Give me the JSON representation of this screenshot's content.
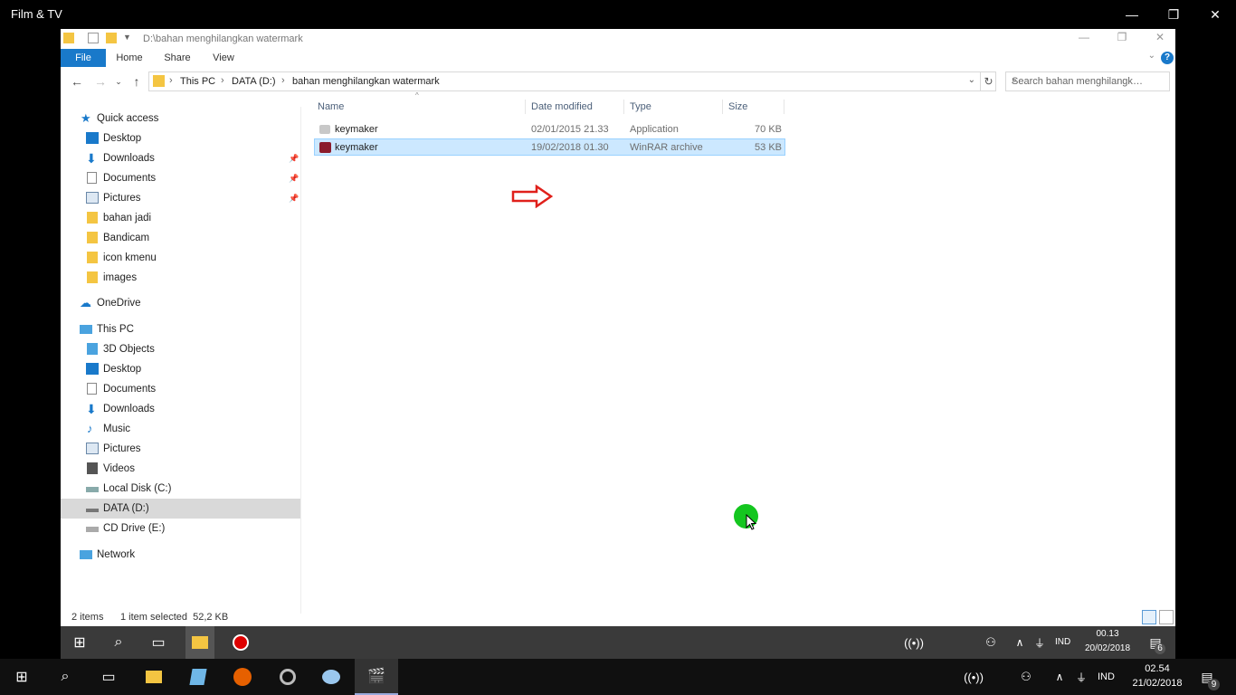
{
  "window": {
    "title": "Film & TV",
    "minimize": "—",
    "restore": "❐",
    "close": "✕"
  },
  "explorer": {
    "path_title": "D:\\bahan menghilangkan watermark",
    "ribbon": {
      "file": "File",
      "home": "Home",
      "share": "Share",
      "view": "View",
      "help": "?"
    },
    "breadcrumb": [
      "This PC",
      "DATA (D:)",
      "bahan menghilangkan watermark"
    ],
    "search_placeholder": "Search bahan menghilangkan watermark",
    "nav": {
      "quick_access": "Quick access",
      "qa_items": [
        "Desktop",
        "Downloads",
        "Documents",
        "Pictures",
        "bahan jadi",
        "Bandicam",
        "icon kmenu",
        "images"
      ],
      "onedrive": "OneDrive",
      "this_pc": "This PC",
      "pc_items": [
        "3D Objects",
        "Desktop",
        "Documents",
        "Downloads",
        "Music",
        "Pictures",
        "Videos",
        "Local Disk (C:)",
        "DATA (D:)",
        "CD Drive (E:)"
      ],
      "network": "Network"
    },
    "columns": {
      "name": "Name",
      "date": "Date modified",
      "type": "Type",
      "size": "Size"
    },
    "files": [
      {
        "name": "keymaker",
        "date": "02/01/2015 21.33",
        "type": "Application",
        "size": "70 KB"
      },
      {
        "name": "keymaker",
        "date": "19/02/2018 01.30",
        "type": "WinRAR archive",
        "size": "53 KB"
      }
    ],
    "status": {
      "items": "2 items",
      "selected": "1 item selected  52,2 KB"
    }
  },
  "inner_taskbar": {
    "lang": "IND",
    "time": "00.13",
    "date": "20/02/2018",
    "notif_count": "6"
  },
  "taskbar": {
    "lang": "IND",
    "time": "02.54",
    "date": "21/02/2018",
    "notif_count": "9"
  },
  "colors": {
    "accent": "#1979ca",
    "selection": "#cce8ff",
    "annotation": "#e0201b",
    "cursor_dot": "#14c61f"
  }
}
